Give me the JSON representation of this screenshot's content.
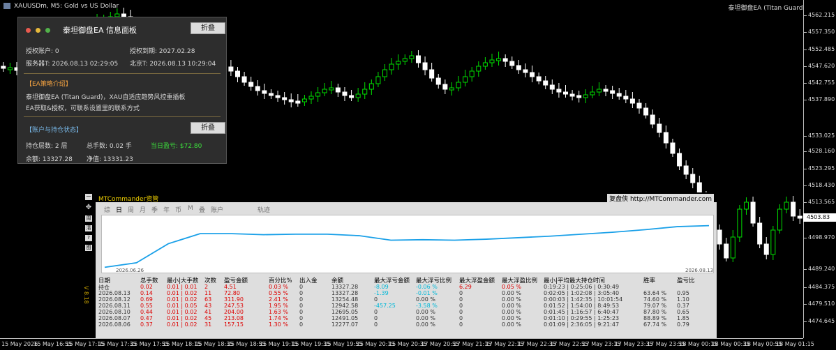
{
  "window": {
    "symbol_title": "XAUUSDm, M5:  Gold vs US Dollar",
    "ea_corner": "泰坦御盘EA (Titan Guard)",
    "current_price": "4503.83"
  },
  "price_axis": [
    "4562.215",
    "4557.350",
    "4552.485",
    "4547.620",
    "4542.755",
    "4537.890",
    "4533.025",
    "4528.160",
    "4523.295",
    "4518.430",
    "4513.565",
    "4508.700",
    "4503.835",
    "4498.970",
    "4489.240",
    "4484.375",
    "4479.510",
    "4474.645"
  ],
  "time_axis": [
    "15 May 2026",
    "15 May 16:55",
    "15 May 17:15",
    "15 May 17:35",
    "15 May 17:55",
    "15 May 18:15",
    "15 May 18:35",
    "15 May 18:55",
    "15 May 19:15",
    "15 May 19:35",
    "15 May 19:55",
    "15 May 20:15",
    "15 May 20:35",
    "17 May 20:55",
    "17 May 21:15",
    "17 May 22:15",
    "17 May 22:35",
    "17 May 22:55",
    "17 May 23:15",
    "17 May 23:35",
    "17 May 23:55",
    "18 May 00:15",
    "18 May 00:35",
    "18 May 00:55",
    "18 May 01:15"
  ],
  "info_panel": {
    "title": "泰坦御盘EA  信息面板",
    "collapse_label": "折叠",
    "account": "授权账户: 0",
    "expiry": "授权到期: 2027.02.28",
    "server_time": "服务器T: 2026.08.13 02:29:05",
    "beijing_time": "北京T: 2026.08.13 10:29:04",
    "strategy_header": "【EA策略介绍】",
    "strategy_line1": "泰坦御盘EA (Titan Guard)，XAU自适应趋势风控重插板",
    "strategy_line2": "EA获取&授权，可联系设置里的联系方式",
    "status_header": "【账户与持仓状态】",
    "status_collapse_label": "折叠",
    "positions": "持仓层数: 2 层",
    "lots": "总手数: 0.02 手",
    "daily_profit": "当日盈亏: $72.80",
    "balance": "余额: 13327.28",
    "equity": "净值: 13331.23"
  },
  "commander": {
    "title": "MTCommander资管",
    "brand": "复盘侠 http://MTCommander.com",
    "side_label": "V 8.18",
    "side_buttons": [
      "一",
      "✥",
      "周",
      "清",
      "?",
      "图"
    ],
    "tabs": [
      "综",
      "日",
      "周",
      "月",
      "季",
      "年",
      "币",
      "M",
      "叠",
      "账户",
      "轨迹"
    ],
    "chart_start": "2026.06.26",
    "chart_end": "2026.08.13",
    "equity_curve": [
      0.05,
      0.14,
      0.52,
      0.72,
      0.72,
      0.7,
      0.71,
      0.71,
      0.68,
      0.59,
      0.6,
      0.59,
      0.61,
      0.64,
      0.67,
      0.71,
      0.75,
      0.8,
      0.86,
      0.88
    ],
    "columns": [
      "日期",
      "总手数",
      "最小|大手数",
      "次数",
      "盈亏金额",
      "百分比%",
      "出入金",
      "余额",
      "最大浮亏金额",
      "最大浮亏比例",
      "最大浮盈金额",
      "最大浮盈比例",
      "最小|平均最大持仓时间",
      "胜率",
      "盈亏比"
    ],
    "rows": [
      [
        "持仓",
        "0.02",
        "0.01 | 0.01",
        "2",
        "4.51",
        "0.03 %",
        "0",
        "13327.28",
        "-8.09",
        "-0.06 %",
        "6.29",
        "0.05 %",
        "0:19:23 | 0:25:06 | 0:30:49",
        "",
        ""
      ],
      [
        "2026.08.13",
        "0.14",
        "0.01 | 0.02",
        "11",
        "72.80",
        "0.55 %",
        "0",
        "13327.28",
        "-1.39",
        "-0.01 %",
        "0",
        "0.00 %",
        "0:02:05 | 1:02:08 | 3:05:40",
        "63.64 %",
        "0.95"
      ],
      [
        "2026.08.12",
        "0.69",
        "0.01 | 0.02",
        "63",
        "311.90",
        "2.41 %",
        "0",
        "13254.48",
        "0",
        "0.00 %",
        "0",
        "0.00 %",
        "0:00:03 | 1:42:35 | 10:01:54",
        "74.60 %",
        "1.10"
      ],
      [
        "2026.08.11",
        "0.55",
        "0.01 | 0.05",
        "43",
        "247.53",
        "1.95 %",
        "0",
        "12942.58",
        "-457.25",
        "-3.58 %",
        "0",
        "0.00 %",
        "0:01:52 | 1:54:00 | 8:49:53",
        "79.07 %",
        "0.37"
      ],
      [
        "2026.08.10",
        "0.44",
        "0.01 | 0.02",
        "41",
        "204.00",
        "1.63 %",
        "0",
        "12695.05",
        "0",
        "0.00 %",
        "0",
        "0.00 %",
        "0:01:45 | 1:16:57 | 6:40:47",
        "87.80 %",
        "0.65"
      ],
      [
        "2026.08.07",
        "0.47",
        "0.01 | 0.02",
        "45",
        "213.08",
        "1.74 %",
        "0",
        "12491.05",
        "0",
        "0.00 %",
        "0",
        "0.00 %",
        "0:01:10 | 0:29:55 | 1:25:23",
        "88.89 %",
        "1.85"
      ],
      [
        "2026.08.06",
        "0.37",
        "0.01 | 0.02",
        "31",
        "157.15",
        "1.30 %",
        "0",
        "12277.07",
        "0",
        "0.00 %",
        "0",
        "0.00 %",
        "0:01:09 | 2:36:05 | 9:21:47",
        "67.74 %",
        "0.79"
      ]
    ]
  }
}
